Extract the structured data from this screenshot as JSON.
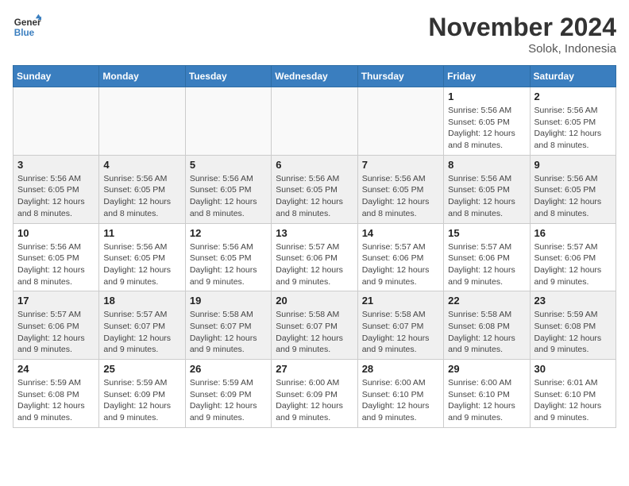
{
  "header": {
    "logo_line1": "General",
    "logo_line2": "Blue",
    "month": "November 2024",
    "location": "Solok, Indonesia"
  },
  "days_of_week": [
    "Sunday",
    "Monday",
    "Tuesday",
    "Wednesday",
    "Thursday",
    "Friday",
    "Saturday"
  ],
  "weeks": [
    [
      {
        "day": "",
        "empty": true
      },
      {
        "day": "",
        "empty": true
      },
      {
        "day": "",
        "empty": true
      },
      {
        "day": "",
        "empty": true
      },
      {
        "day": "",
        "empty": true
      },
      {
        "day": "1",
        "sunrise": "Sunrise: 5:56 AM",
        "sunset": "Sunset: 6:05 PM",
        "daylight": "Daylight: 12 hours and 8 minutes."
      },
      {
        "day": "2",
        "sunrise": "Sunrise: 5:56 AM",
        "sunset": "Sunset: 6:05 PM",
        "daylight": "Daylight: 12 hours and 8 minutes."
      }
    ],
    [
      {
        "day": "3",
        "sunrise": "Sunrise: 5:56 AM",
        "sunset": "Sunset: 6:05 PM",
        "daylight": "Daylight: 12 hours and 8 minutes."
      },
      {
        "day": "4",
        "sunrise": "Sunrise: 5:56 AM",
        "sunset": "Sunset: 6:05 PM",
        "daylight": "Daylight: 12 hours and 8 minutes."
      },
      {
        "day": "5",
        "sunrise": "Sunrise: 5:56 AM",
        "sunset": "Sunset: 6:05 PM",
        "daylight": "Daylight: 12 hours and 8 minutes."
      },
      {
        "day": "6",
        "sunrise": "Sunrise: 5:56 AM",
        "sunset": "Sunset: 6:05 PM",
        "daylight": "Daylight: 12 hours and 8 minutes."
      },
      {
        "day": "7",
        "sunrise": "Sunrise: 5:56 AM",
        "sunset": "Sunset: 6:05 PM",
        "daylight": "Daylight: 12 hours and 8 minutes."
      },
      {
        "day": "8",
        "sunrise": "Sunrise: 5:56 AM",
        "sunset": "Sunset: 6:05 PM",
        "daylight": "Daylight: 12 hours and 8 minutes."
      },
      {
        "day": "9",
        "sunrise": "Sunrise: 5:56 AM",
        "sunset": "Sunset: 6:05 PM",
        "daylight": "Daylight: 12 hours and 8 minutes."
      }
    ],
    [
      {
        "day": "10",
        "sunrise": "Sunrise: 5:56 AM",
        "sunset": "Sunset: 6:05 PM",
        "daylight": "Daylight: 12 hours and 8 minutes."
      },
      {
        "day": "11",
        "sunrise": "Sunrise: 5:56 AM",
        "sunset": "Sunset: 6:05 PM",
        "daylight": "Daylight: 12 hours and 9 minutes."
      },
      {
        "day": "12",
        "sunrise": "Sunrise: 5:56 AM",
        "sunset": "Sunset: 6:05 PM",
        "daylight": "Daylight: 12 hours and 9 minutes."
      },
      {
        "day": "13",
        "sunrise": "Sunrise: 5:57 AM",
        "sunset": "Sunset: 6:06 PM",
        "daylight": "Daylight: 12 hours and 9 minutes."
      },
      {
        "day": "14",
        "sunrise": "Sunrise: 5:57 AM",
        "sunset": "Sunset: 6:06 PM",
        "daylight": "Daylight: 12 hours and 9 minutes."
      },
      {
        "day": "15",
        "sunrise": "Sunrise: 5:57 AM",
        "sunset": "Sunset: 6:06 PM",
        "daylight": "Daylight: 12 hours and 9 minutes."
      },
      {
        "day": "16",
        "sunrise": "Sunrise: 5:57 AM",
        "sunset": "Sunset: 6:06 PM",
        "daylight": "Daylight: 12 hours and 9 minutes."
      }
    ],
    [
      {
        "day": "17",
        "sunrise": "Sunrise: 5:57 AM",
        "sunset": "Sunset: 6:06 PM",
        "daylight": "Daylight: 12 hours and 9 minutes."
      },
      {
        "day": "18",
        "sunrise": "Sunrise: 5:57 AM",
        "sunset": "Sunset: 6:07 PM",
        "daylight": "Daylight: 12 hours and 9 minutes."
      },
      {
        "day": "19",
        "sunrise": "Sunrise: 5:58 AM",
        "sunset": "Sunset: 6:07 PM",
        "daylight": "Daylight: 12 hours and 9 minutes."
      },
      {
        "day": "20",
        "sunrise": "Sunrise: 5:58 AM",
        "sunset": "Sunset: 6:07 PM",
        "daylight": "Daylight: 12 hours and 9 minutes."
      },
      {
        "day": "21",
        "sunrise": "Sunrise: 5:58 AM",
        "sunset": "Sunset: 6:07 PM",
        "daylight": "Daylight: 12 hours and 9 minutes."
      },
      {
        "day": "22",
        "sunrise": "Sunrise: 5:58 AM",
        "sunset": "Sunset: 6:08 PM",
        "daylight": "Daylight: 12 hours and 9 minutes."
      },
      {
        "day": "23",
        "sunrise": "Sunrise: 5:59 AM",
        "sunset": "Sunset: 6:08 PM",
        "daylight": "Daylight: 12 hours and 9 minutes."
      }
    ],
    [
      {
        "day": "24",
        "sunrise": "Sunrise: 5:59 AM",
        "sunset": "Sunset: 6:08 PM",
        "daylight": "Daylight: 12 hours and 9 minutes."
      },
      {
        "day": "25",
        "sunrise": "Sunrise: 5:59 AM",
        "sunset": "Sunset: 6:09 PM",
        "daylight": "Daylight: 12 hours and 9 minutes."
      },
      {
        "day": "26",
        "sunrise": "Sunrise: 5:59 AM",
        "sunset": "Sunset: 6:09 PM",
        "daylight": "Daylight: 12 hours and 9 minutes."
      },
      {
        "day": "27",
        "sunrise": "Sunrise: 6:00 AM",
        "sunset": "Sunset: 6:09 PM",
        "daylight": "Daylight: 12 hours and 9 minutes."
      },
      {
        "day": "28",
        "sunrise": "Sunrise: 6:00 AM",
        "sunset": "Sunset: 6:10 PM",
        "daylight": "Daylight: 12 hours and 9 minutes."
      },
      {
        "day": "29",
        "sunrise": "Sunrise: 6:00 AM",
        "sunset": "Sunset: 6:10 PM",
        "daylight": "Daylight: 12 hours and 9 minutes."
      },
      {
        "day": "30",
        "sunrise": "Sunrise: 6:01 AM",
        "sunset": "Sunset: 6:10 PM",
        "daylight": "Daylight: 12 hours and 9 minutes."
      }
    ]
  ]
}
